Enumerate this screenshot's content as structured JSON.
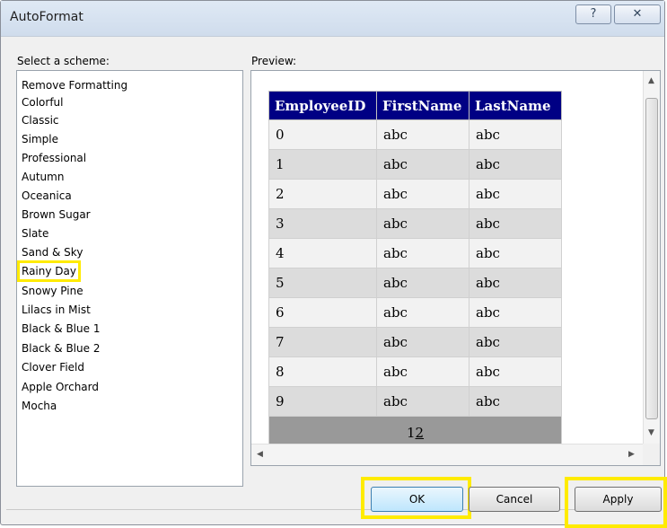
{
  "window": {
    "title": "AutoFormat",
    "help_glyph": "?",
    "close_glyph": "✕"
  },
  "scheme": {
    "label": "Select a scheme:",
    "items": [
      "Remove Formatting",
      "Colorful",
      "Classic",
      "Simple",
      "Professional",
      "Autumn",
      "Oceanica",
      "Brown Sugar",
      "Slate",
      "Sand & Sky",
      "Rainy Day",
      "Snowy Pine",
      "Lilacs in Mist",
      "Black & Blue 1",
      "Black & Blue 2",
      "Clover Field",
      "Apple Orchard",
      "Mocha"
    ],
    "selected": "Rainy Day"
  },
  "preview": {
    "label": "Preview:",
    "columns": [
      "EmployeeID",
      "FirstName",
      "LastName"
    ],
    "rows": [
      [
        "0",
        "abc",
        "abc"
      ],
      [
        "1",
        "abc",
        "abc"
      ],
      [
        "2",
        "abc",
        "abc"
      ],
      [
        "3",
        "abc",
        "abc"
      ],
      [
        "4",
        "abc",
        "abc"
      ],
      [
        "5",
        "abc",
        "abc"
      ],
      [
        "6",
        "abc",
        "abc"
      ],
      [
        "7",
        "abc",
        "abc"
      ],
      [
        "8",
        "abc",
        "abc"
      ],
      [
        "9",
        "abc",
        "abc"
      ]
    ],
    "pager": {
      "current": "1",
      "next": "2"
    }
  },
  "buttons": {
    "ok": "OK",
    "cancel": "Cancel",
    "apply": "Apply"
  },
  "colors": {
    "header_bg": "#000084",
    "highlight": "#ffeb00",
    "pager_bg": "#999999"
  }
}
